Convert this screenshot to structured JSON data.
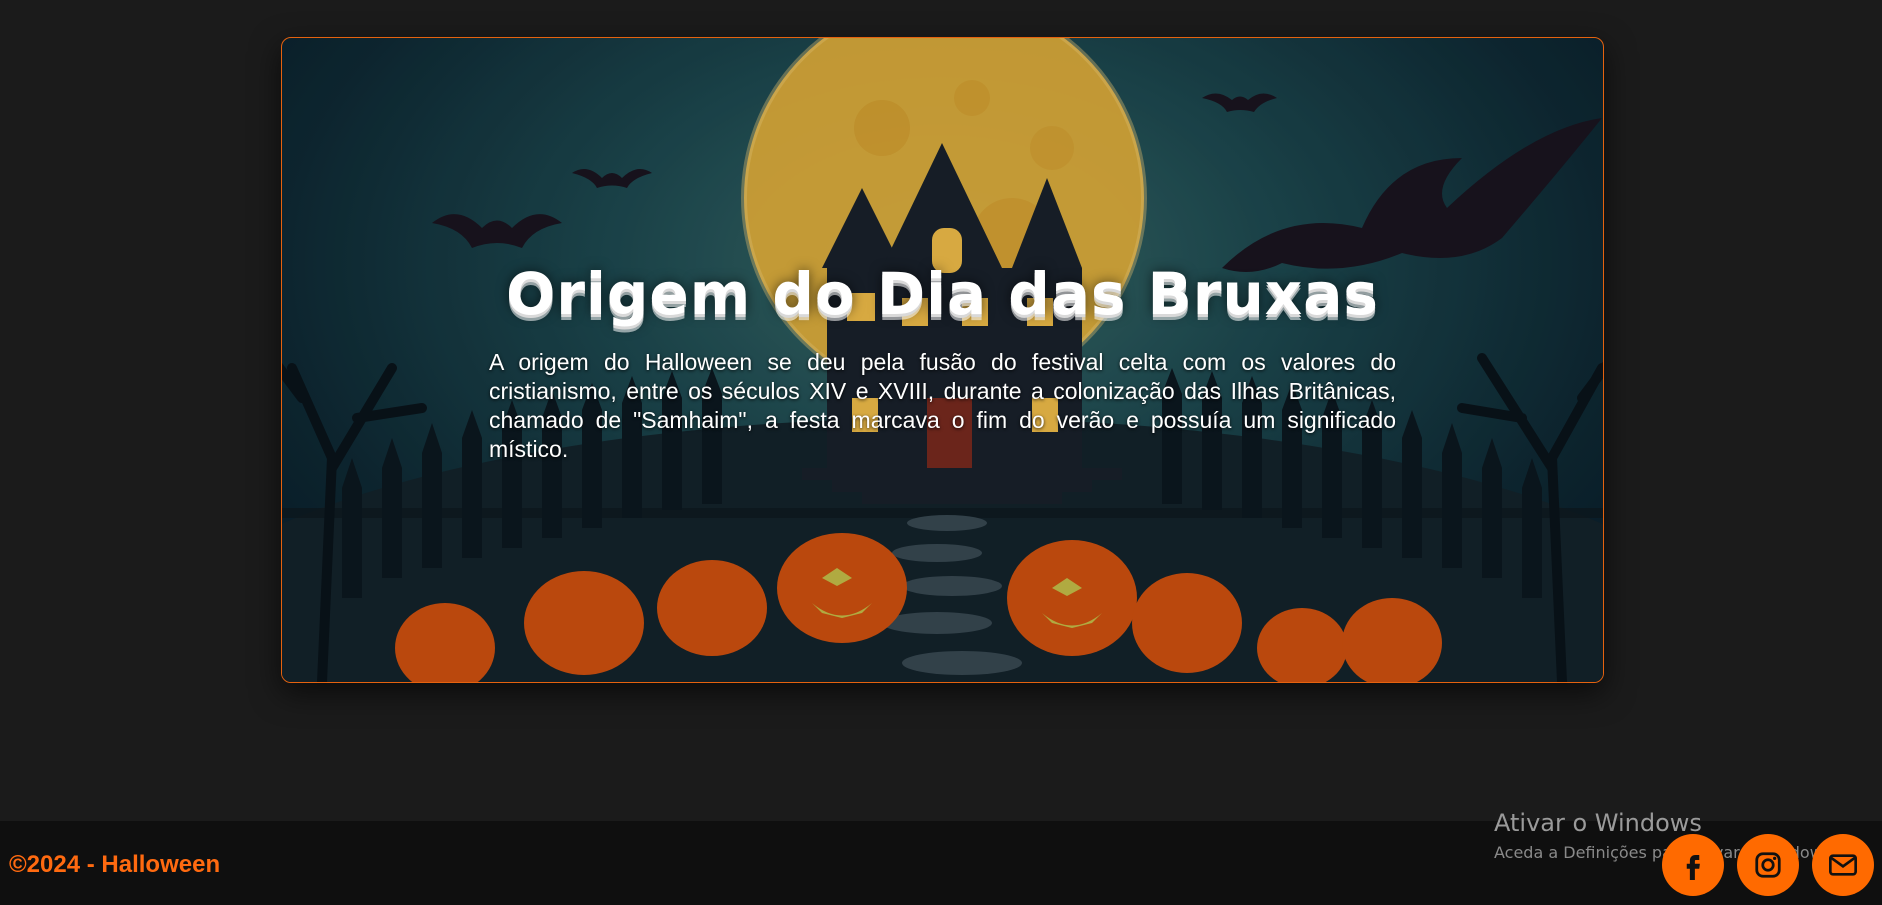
{
  "hero": {
    "title": "Origem do Dia das Bruxas",
    "paragraph": "A origem do Halloween se deu pela fusão do festival celta com os valores do cristianismo, entre os séculos XIV e XVIII, durante a colonização das Ilhas Britânicas, chamado de \"Samhaim\", a festa marcava o fim do verão e possuía um significado místico.",
    "background_icon": "haunted-house-pumpkins-illustration"
  },
  "footer": {
    "copyright": "©2024 - Halloween",
    "social": [
      {
        "icon": "facebook-icon"
      },
      {
        "icon": "instagram-icon"
      },
      {
        "icon": "email-icon"
      }
    ]
  },
  "watermark": {
    "title": "Ativar o Windows",
    "subtitle": "Aceda a Definições para ativar o Windows."
  },
  "colors": {
    "accent": "#ff6a00",
    "background": "#1b1b1b",
    "footer": "#0f0f0f",
    "card_border": "#e5620f"
  }
}
